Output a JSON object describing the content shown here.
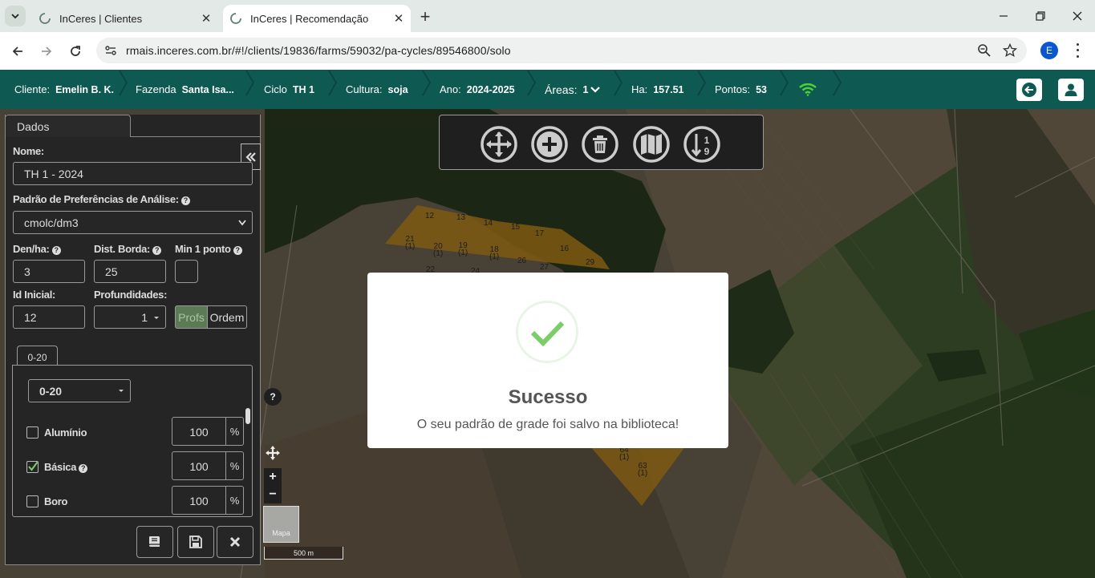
{
  "browser": {
    "tabs": [
      {
        "title": "InCeres | Clientes",
        "active": false
      },
      {
        "title": "InCeres | Recomendação",
        "active": true
      }
    ],
    "url": "rmais.inceres.com.br/#!/clients/19836/farms/59032/pa-cycles/89546800/solo",
    "profile_initial": "E"
  },
  "header": {
    "cliente_label": "Cliente:",
    "cliente_value": "Emelin B. K.",
    "fazenda_label": "Fazenda",
    "fazenda_value": "Santa Isa...",
    "ciclo_label": "Ciclo",
    "ciclo_value": "TH 1",
    "cultura_label": "Cultura:",
    "cultura_value": "soja",
    "ano_label": "Ano:",
    "ano_value": "2024-2025",
    "areas_label": "Áreas:",
    "areas_value": "1",
    "ha_label": "Ha:",
    "ha_value": "157.51",
    "pontos_label": "Pontos:",
    "pontos_value": "53",
    "signal_color": "#4cd137"
  },
  "panel": {
    "tab_label": "Dados",
    "nome_label": "Nome:",
    "nome_value": "TH 1 - 2024",
    "padrao_label": "Padrão de Preferências de Análise:",
    "padrao_value": "cmolc/dm3",
    "den_label": "Den/ha:",
    "den_value": "3",
    "dist_label": "Dist. Borda:",
    "dist_value": "25",
    "min_label": "Min 1 ponto",
    "id_label": "Id Inicial:",
    "id_value": "12",
    "prof_label": "Profundidades:",
    "prof_value": "1",
    "toggle_profs": "Profs",
    "toggle_ordem": "Ordem",
    "depth_tab": "0-20",
    "depth_select": "0-20",
    "nutrients": [
      {
        "name": "Alumínio",
        "checked": false,
        "help": false,
        "value": "100",
        "unit": "%"
      },
      {
        "name": "Básica",
        "checked": true,
        "help": true,
        "value": "100",
        "unit": "%"
      },
      {
        "name": "Boro",
        "checked": false,
        "help": false,
        "value": "100",
        "unit": "%"
      }
    ]
  },
  "map": {
    "minimap_label": "Mapa",
    "scale_label": "500 m",
    "zoom_in": "+",
    "zoom_out": "−",
    "help": "?",
    "field_color": "#d99a1e",
    "points": [
      {
        "id": "12",
        "sub": "(1)"
      },
      {
        "id": "13",
        "sub": "(1)"
      },
      {
        "id": "14",
        "sub": "(1)"
      },
      {
        "id": "15",
        "sub": "(1)"
      },
      {
        "id": "17",
        "sub": "(1)"
      },
      {
        "id": "16",
        "sub": "(1)"
      },
      {
        "id": "21",
        "sub": "(1)"
      },
      {
        "id": "20",
        "sub": "(1)"
      },
      {
        "id": "19",
        "sub": "(1)"
      },
      {
        "id": "18",
        "sub": "(1)"
      },
      {
        "id": "26",
        "sub": "(1)"
      },
      {
        "id": "27",
        "sub": "(1)"
      },
      {
        "id": "29",
        "sub": "(1)"
      },
      {
        "id": "22",
        "sub": ""
      },
      {
        "id": "24",
        "sub": ""
      },
      {
        "id": "64",
        "sub": "(1)"
      },
      {
        "id": "63",
        "sub": "(1)"
      }
    ]
  },
  "modal": {
    "title": "Sucesso",
    "message": "O seu padrão de grade foi salvo na biblioteca!",
    "check_color": "#7ccd6a"
  }
}
